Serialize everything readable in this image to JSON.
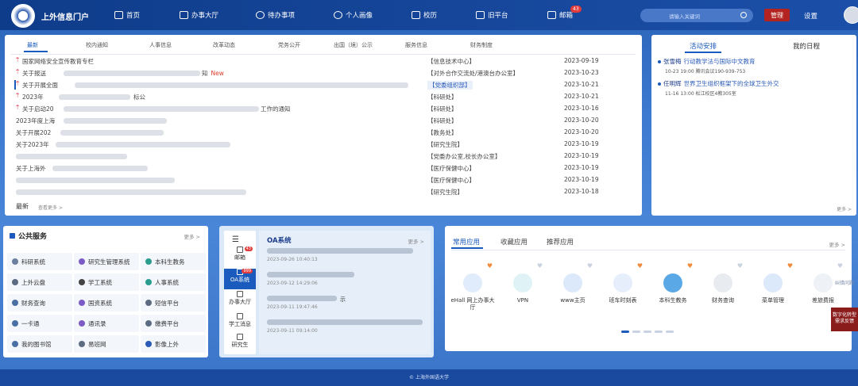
{
  "header": {
    "brand": "上外信息门户",
    "nav": [
      {
        "label": "首页",
        "icon": "home-icon"
      },
      {
        "label": "办事大厅",
        "icon": "people-icon"
      },
      {
        "label": "待办事项",
        "icon": "bell-icon"
      },
      {
        "label": "个人画像",
        "icon": "user-icon"
      },
      {
        "label": "校历",
        "icon": "calendar-icon"
      },
      {
        "label": "旧平台",
        "icon": "monitor-icon"
      },
      {
        "label": "邮箱",
        "icon": "mail-icon"
      }
    ],
    "mail_badge": "43",
    "search_placeholder": "请输入关键词",
    "manage_label": "管理",
    "settings_label": "设置"
  },
  "news": {
    "tabs": [
      "最新",
      "校内通知",
      "人事信息",
      "改革动态",
      "党务公开",
      "出国（境）公示",
      "服务信息",
      "财务制度"
    ],
    "rows": [
      {
        "title": "国家网络安全宣传教育专栏",
        "dept": "【信息技术中心】",
        "date": "2023-09-19",
        "pinned": true
      },
      {
        "title": "关于报送",
        "suffix": "知",
        "new": "New",
        "dept": "【对外合作交流处/港澳台办公室】",
        "date": "2023-10-23",
        "pinned": true
      },
      {
        "title": "关于开展全面",
        "dept": "【党委组织部】",
        "date": "2023-10-21",
        "pinned": true,
        "highlight": true
      },
      {
        "title": "2023年",
        "suffix": "标公",
        "dept": "【科研处】",
        "date": "2023-10-21",
        "pinned": true
      },
      {
        "title": "关于启动20",
        "suffix": "工作的通知",
        "dept": "【科研处】",
        "date": "2023-10-16",
        "pinned": true
      },
      {
        "title": "2023年度上海",
        "dept": "【科研处】",
        "date": "2023-10-20",
        "pinned": false
      },
      {
        "title": "关于开展202",
        "dept": "【教务处】",
        "date": "2023-10-20",
        "pinned": false
      },
      {
        "title": "关于2023年",
        "dept": "【研究生院】",
        "date": "2023-10-19",
        "pinned": false
      },
      {
        "title": "",
        "dept": "【党委办公室,校长办公室】",
        "date": "2023-10-19",
        "pinned": false
      },
      {
        "title": "关于上海外",
        "dept": "【医疗保健中心】",
        "date": "2023-10-19",
        "pinned": false
      },
      {
        "title": "",
        "dept": "【医疗保健中心】",
        "date": "2023-10-19",
        "pinned": false
      },
      {
        "title": "",
        "dept": "【研究生院】",
        "date": "2023-10-18",
        "pinned": false
      }
    ],
    "footer_label": "最新",
    "more_label": "查看更多 >"
  },
  "activity": {
    "tabs": [
      "活动安排",
      "我的日程"
    ],
    "items": [
      {
        "who": "张雪梅",
        "what": "行动教学法与国际中文教育",
        "meta": "10-23 19:00 腾讯会议190-939-753"
      },
      {
        "who": "任明辉",
        "what": "世界卫生组织框架下的全球卫生外交",
        "meta": "11-16 13:00 松江校区4教305室"
      }
    ],
    "more": "更多 >"
  },
  "public_service": {
    "title": "公共服务",
    "more": "更多 >",
    "items": [
      {
        "label": "科研系统",
        "color": "#6b7f9e"
      },
      {
        "label": "研究生管理系统",
        "color": "#7c5cc4"
      },
      {
        "label": "本科生教务",
        "color": "#2a9d8f"
      },
      {
        "label": "上外云盘",
        "color": "#5d6b82"
      },
      {
        "label": "学工系统",
        "color": "#444444"
      },
      {
        "label": "人事系统",
        "color": "#2a9d8f"
      },
      {
        "label": "财务查询",
        "color": "#4a6fa5"
      },
      {
        "label": "国资系统",
        "color": "#7c5cc4"
      },
      {
        "label": "短信平台",
        "color": "#5d6b82"
      },
      {
        "label": "一卡通",
        "color": "#4a6fa5"
      },
      {
        "label": "通讯录",
        "color": "#7c5cc4"
      },
      {
        "label": "缴费平台",
        "color": "#5d6b82"
      },
      {
        "label": "我的图书馆",
        "color": "#4a6fa5"
      },
      {
        "label": "易班网",
        "color": "#5d6b82"
      },
      {
        "label": "影像上外",
        "color": "#2a5bb8"
      }
    ]
  },
  "oa": {
    "title": "OA系统",
    "more": "更多 >",
    "nav": [
      {
        "label": "邮箱",
        "badge": "43"
      },
      {
        "label": "OA系统",
        "badge": "999"
      },
      {
        "label": "办事大厅",
        "badge": ""
      },
      {
        "label": "学工消息",
        "badge": ""
      },
      {
        "label": "研究生",
        "badge": ""
      }
    ],
    "entries": [
      {
        "time": "2023-09-26 10:40:13"
      },
      {
        "time": "2023-09-12 14:29:06"
      },
      {
        "time": "2023-09-11 19:47:46"
      },
      {
        "time": "2023-09-11 09:14:00"
      }
    ],
    "entry_tag": "示"
  },
  "apps": {
    "tabs": [
      "常用应用",
      "收藏应用",
      "推荐应用"
    ],
    "more": "更多 >",
    "items": [
      {
        "label": "eHall 网上办事大厅",
        "color": "#e0ecfb",
        "heart": "#f08a3c"
      },
      {
        "label": "VPN",
        "color": "#dff3f6",
        "heart": "#c9d2e0"
      },
      {
        "label": "www主页",
        "color": "#dbe9fb",
        "heart": "#c9d2e0"
      },
      {
        "label": "班车时刻表",
        "color": "#e6eefb",
        "heart": "#f08a3c"
      },
      {
        "label": "本科生教务",
        "color": "#5aa9e6",
        "heart": "#f08a3c"
      },
      {
        "label": "财务查询",
        "color": "#e8ebf0",
        "heart": "#c9d2e0"
      },
      {
        "label": "菜单管理",
        "color": "#dbe9fb",
        "heart": "#f08a3c"
      },
      {
        "label": "差旅费报",
        "color": "#eef1f6",
        "heart": "#c9d2e0"
      }
    ]
  },
  "side_float": {
    "label": "数字化转型需求反馈",
    "label2": "纠错问题"
  },
  "footer": "© 上海外国语大学"
}
